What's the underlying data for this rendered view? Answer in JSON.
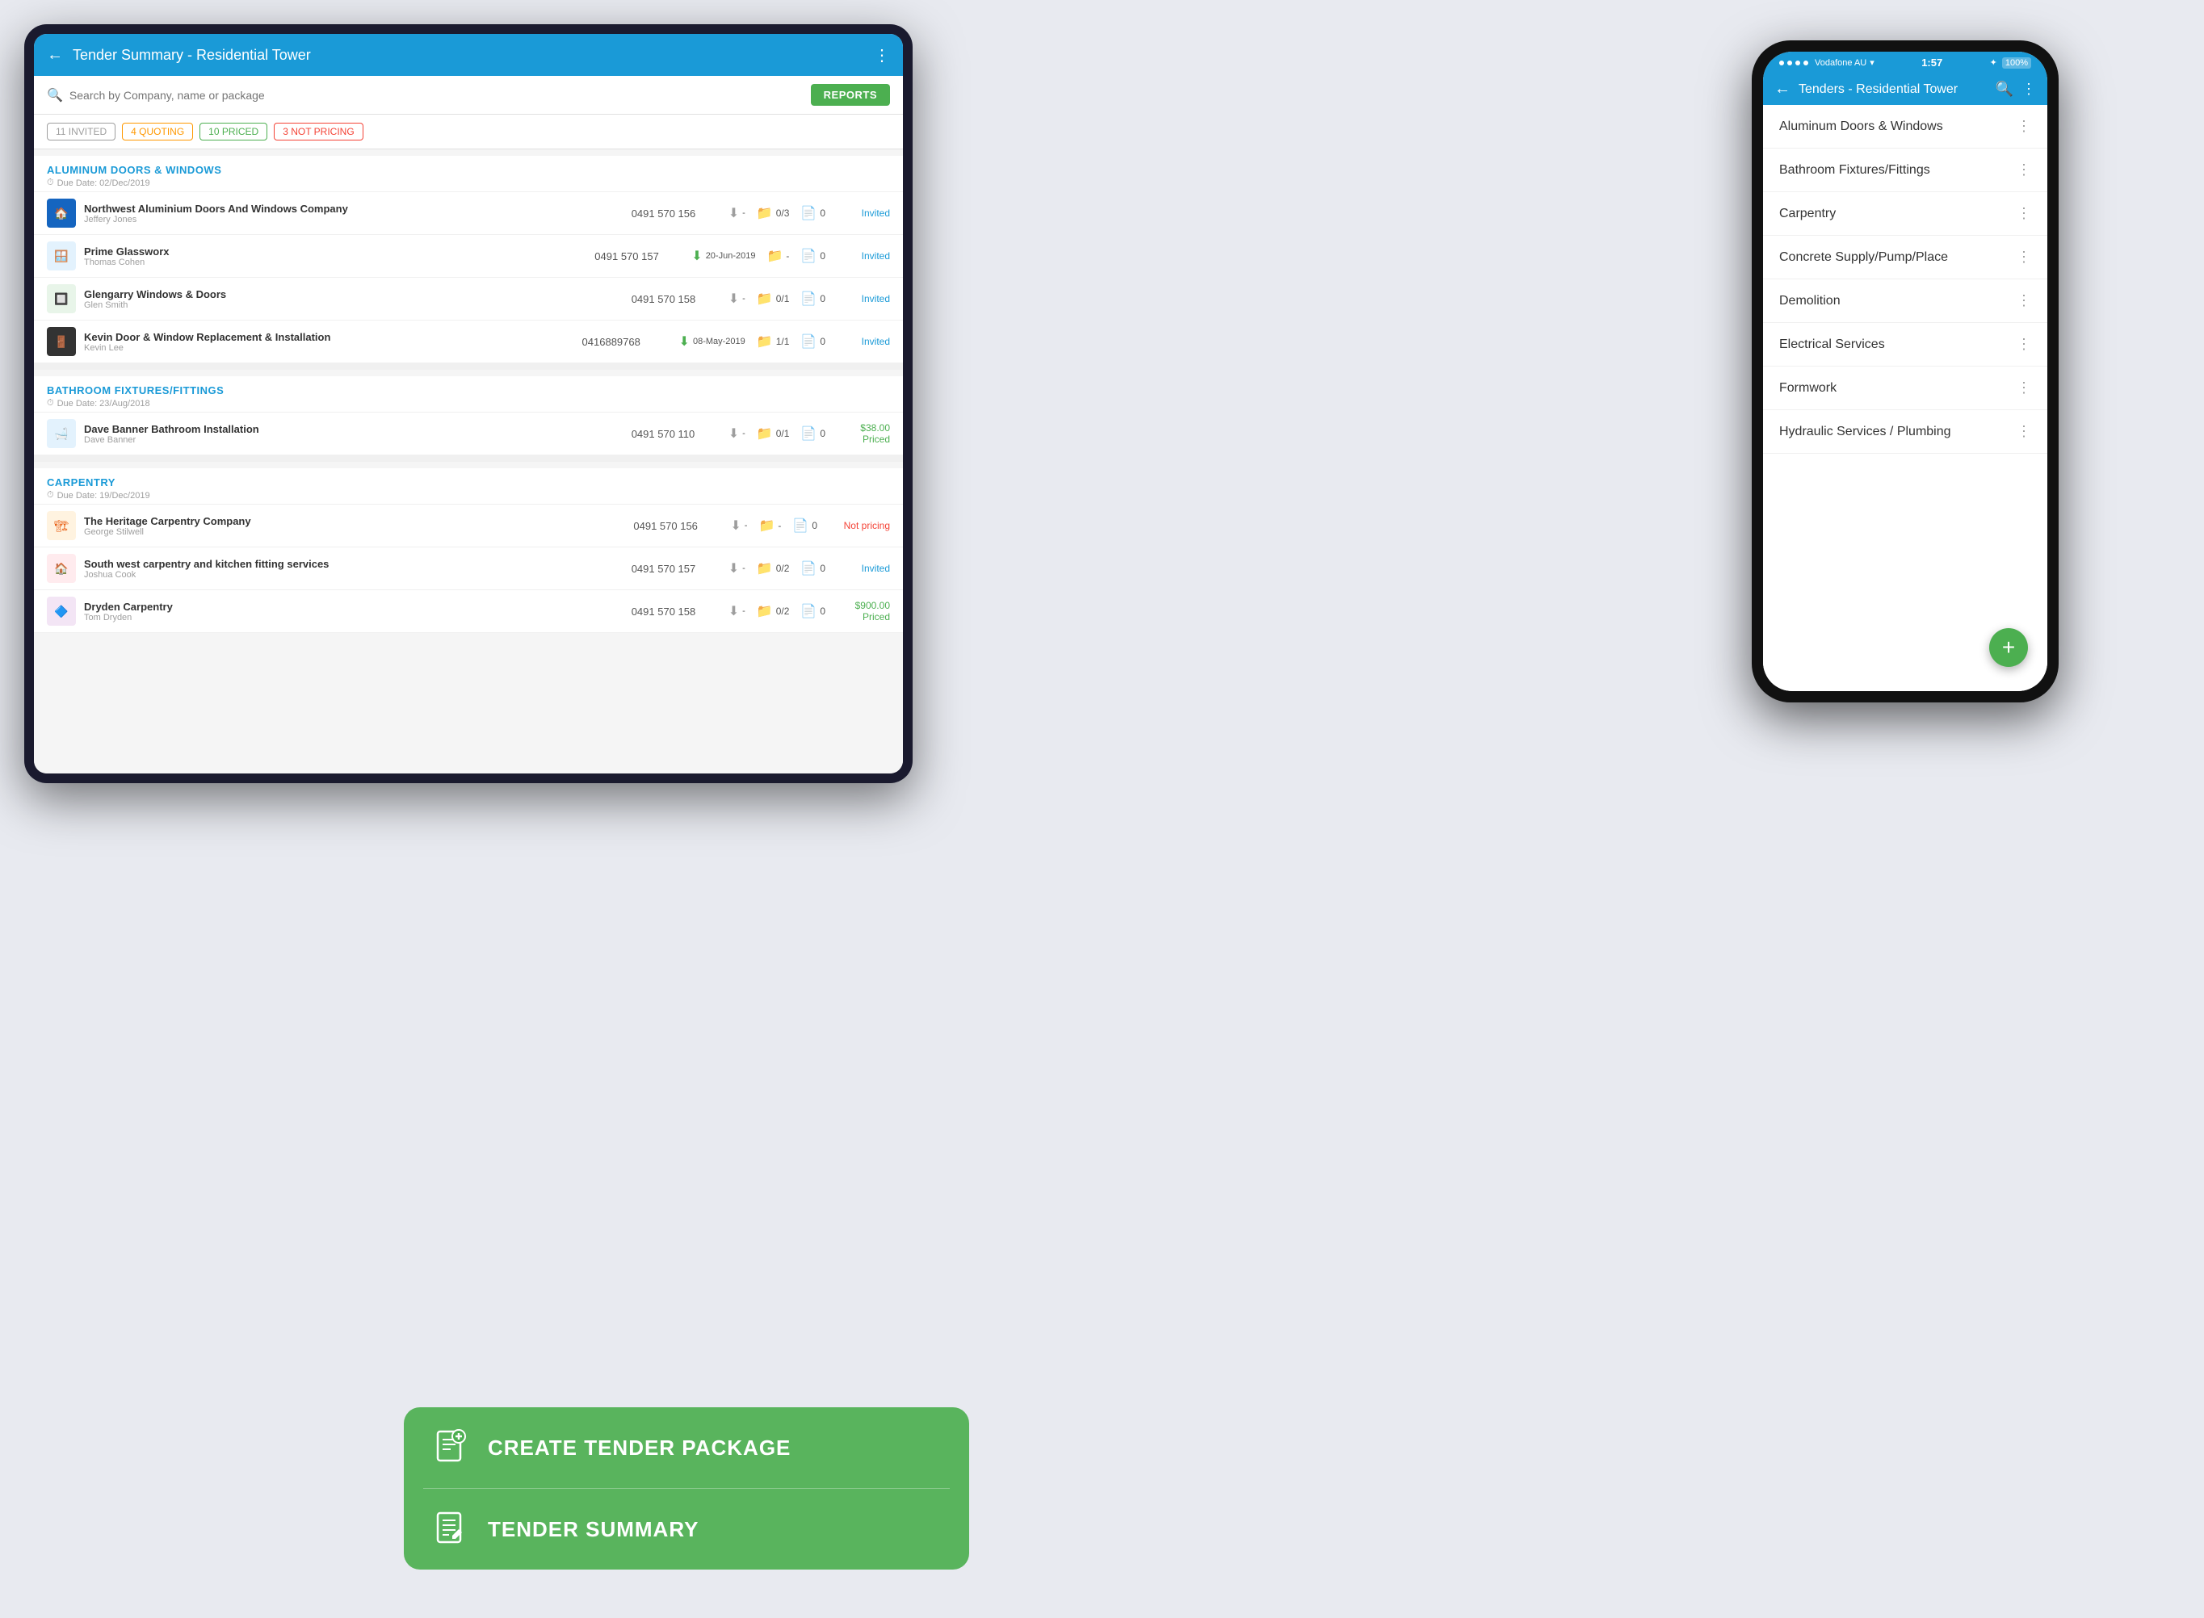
{
  "tablet": {
    "header": {
      "back_label": "←",
      "title": "Tender Summary - Residential Tower",
      "dots_label": "⋮"
    },
    "search": {
      "placeholder": "Search by Company, name or package"
    },
    "reports_btn": "REPORTS",
    "filters": [
      {
        "label": "11 INVITED",
        "type": "invited"
      },
      {
        "label": "4 QUOTING",
        "type": "quoting"
      },
      {
        "label": "10 PRICED",
        "type": "priced"
      },
      {
        "label": "3 NOT PRICING",
        "type": "not-pricing"
      }
    ],
    "sections": [
      {
        "id": "aluminum",
        "title": "ALUMINUM DOORS & WINDOWS",
        "due": "Due Date: 02/Dec/2019",
        "contractors": [
          {
            "name": "Northwest Aluminium Doors And Windows Company",
            "contact": "Jeffery Jones",
            "phone": "0491 570 156",
            "download_date": "-",
            "addenda": "0/3",
            "docs": "0",
            "status": "Invited",
            "status_type": "invited"
          },
          {
            "name": "Prime Glassworx",
            "contact": "Thomas Cohen",
            "phone": "0491 570 157",
            "download_date": "20-Jun-2019",
            "addenda": "-",
            "docs": "0",
            "status": "Invited",
            "status_type": "invited"
          },
          {
            "name": "Glengarry Windows & Doors",
            "contact": "Glen Smith",
            "phone": "0491 570 158",
            "download_date": "-",
            "addenda": "0/1",
            "docs": "0",
            "status": "Invited",
            "status_type": "invited"
          },
          {
            "name": "Kevin Door & Window Replacement & Installation",
            "contact": "Kevin Lee",
            "phone": "0416889768",
            "download_date": "08-May-2019",
            "addenda": "1/1",
            "docs": "0",
            "status": "Invited",
            "status_type": "invited"
          }
        ]
      },
      {
        "id": "bathroom",
        "title": "BATHROOM FIXTURES/FITTINGS",
        "due": "Due Date: 23/Aug/2018",
        "contractors": [
          {
            "name": "Dave Banner Bathroom Installation",
            "contact": "Dave Banner",
            "phone": "0491 570 110",
            "download_date": "-",
            "addenda": "0/1",
            "docs": "0",
            "status": "$38.00\nPriced",
            "status_type": "priced"
          }
        ]
      },
      {
        "id": "carpentry",
        "title": "CARPENTRY",
        "due": "Due Date: 19/Dec/2019",
        "contractors": [
          {
            "name": "The Heritage Carpentry Company",
            "contact": "George Stilwell",
            "phone": "0491 570 156",
            "download_date": "-",
            "addenda": "-",
            "docs": "0",
            "status": "Not pricing",
            "status_type": "not-pricing"
          },
          {
            "name": "South west carpentry and kitchen fitting services",
            "contact": "Joshua Cook",
            "phone": "0491 570 157",
            "download_date": "-",
            "addenda": "0/2",
            "docs": "0",
            "status": "Invited",
            "status_type": "invited"
          },
          {
            "name": "Dryden Carpentry",
            "contact": "Tom Dryden",
            "phone": "0491 570 158",
            "download_date": "-",
            "addenda": "0/2",
            "docs": "0",
            "status": "$900.00\nPriced",
            "status_type": "priced"
          }
        ]
      }
    ]
  },
  "phone": {
    "status_bar": {
      "dots": "●●●●",
      "carrier": "Vodafone AU",
      "wifi": "▾",
      "time": "1:57",
      "bluetooth": "✦",
      "battery": "100%"
    },
    "header": {
      "back_label": "←",
      "title": "Tenders - Residential Tower",
      "search_icon": "🔍",
      "dots_label": "⋮"
    },
    "list_items": [
      {
        "label": "Aluminum Doors & Windows"
      },
      {
        "label": "Bathroom Fixtures/Fittings"
      },
      {
        "label": "Carpentry"
      },
      {
        "label": "Concrete Supply/Pump/Place"
      },
      {
        "label": "Demolition"
      },
      {
        "label": "Electrical Services"
      },
      {
        "label": "Formwork"
      },
      {
        "label": "Hydraulic Services / Plumbing"
      }
    ],
    "fab_label": "+"
  },
  "overlay": {
    "create_label": "CREATE TENDER PACKAGE",
    "summary_label": "TENDER SUMMARY"
  }
}
